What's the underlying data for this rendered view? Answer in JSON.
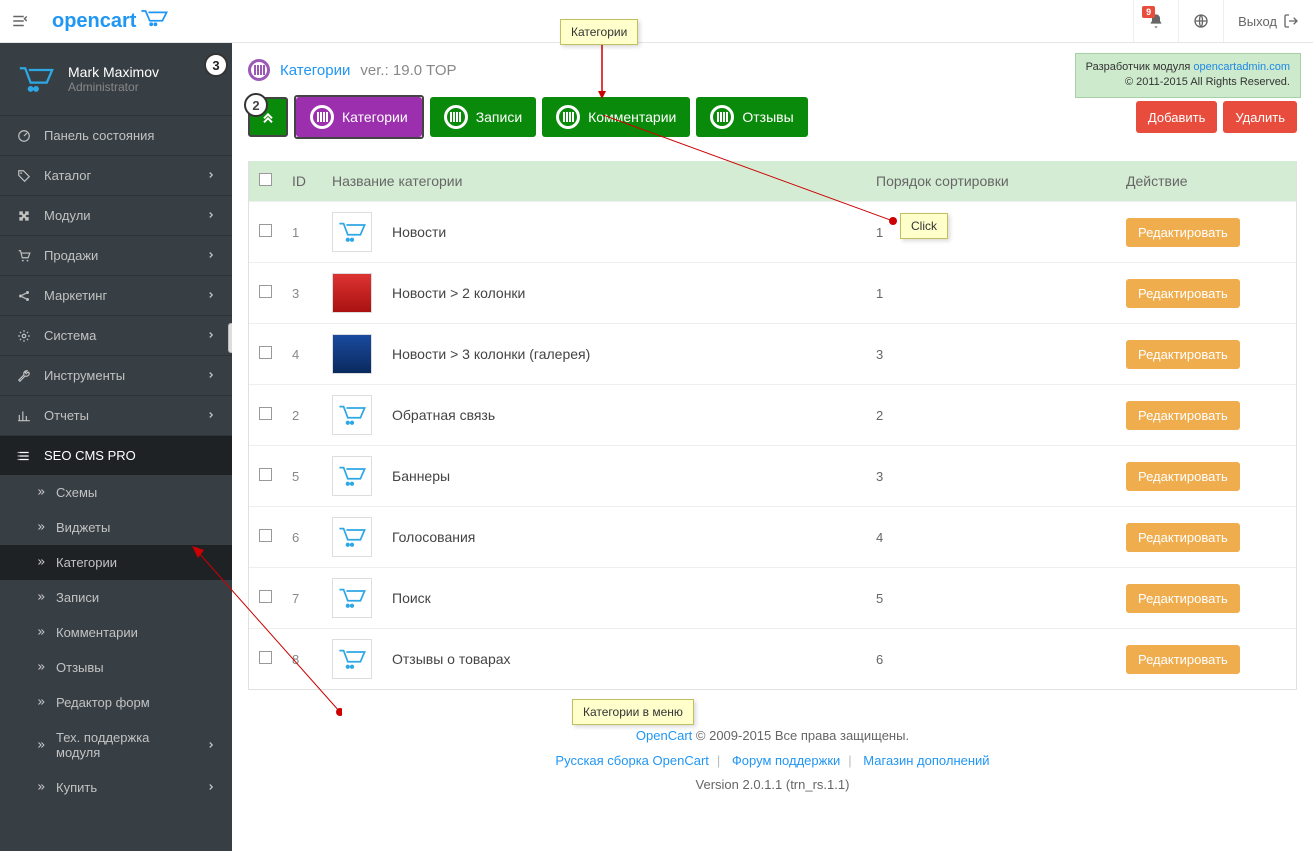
{
  "topbar": {
    "logo_text": "opencart",
    "badge_count": "9",
    "logout_label": "Выход"
  },
  "profile": {
    "name": "Mark Maximov",
    "role": "Administrator",
    "badge": "3"
  },
  "nav": [
    {
      "icon": "dashboard",
      "label": "Панель состояния",
      "chev": false
    },
    {
      "icon": "tag",
      "label": "Каталог",
      "chev": true
    },
    {
      "icon": "puzzle",
      "label": "Модули",
      "chev": true
    },
    {
      "icon": "cart",
      "label": "Продажи",
      "chev": true
    },
    {
      "icon": "share",
      "label": "Маркетинг",
      "chev": true
    },
    {
      "icon": "gear",
      "label": "Система",
      "chev": true
    },
    {
      "icon": "wrench",
      "label": "Инструменты",
      "chev": true
    },
    {
      "icon": "chart",
      "label": "Отчеты",
      "chev": true
    },
    {
      "icon": "list",
      "label": "SEO CMS PRO",
      "chev": false,
      "active": true
    }
  ],
  "subnav": [
    {
      "label": "Схемы"
    },
    {
      "label": "Виджеты"
    },
    {
      "label": "Категории",
      "active": true
    },
    {
      "label": "Записи"
    },
    {
      "label": "Комментарии"
    },
    {
      "label": "Отзывы"
    },
    {
      "label": "Редактор форм"
    },
    {
      "label": "Тех. поддержка модуля",
      "chev": true
    },
    {
      "label": "Купить",
      "chev": true
    }
  ],
  "devbox": {
    "line1_prefix": "Разработчик модуля ",
    "line1_link": "opencartadmin.com",
    "line2": "© 2011-2015 All Rights Reserved."
  },
  "breadcrumb": {
    "title": "Категории",
    "version": " ver.: 19.0 TOP",
    "badge": "2"
  },
  "tabs": [
    {
      "label": "Категории",
      "active": true
    },
    {
      "label": "Записи"
    },
    {
      "label": "Комментарии"
    },
    {
      "label": "Отзывы"
    }
  ],
  "actions": {
    "add": "Добавить",
    "delete": "Удалить"
  },
  "table": {
    "headers": {
      "id": "ID",
      "name": "Название категории",
      "sort": "Порядок сортировки",
      "action": "Действие"
    },
    "rows": [
      {
        "id": "1",
        "name": "Новости",
        "sort": "1",
        "img": "logo"
      },
      {
        "id": "3",
        "name": "Новости > 2 колонки",
        "sort": "1",
        "img": "photo1"
      },
      {
        "id": "4",
        "name": "Новости > 3 колонки (галерея)",
        "sort": "3",
        "img": "photo2"
      },
      {
        "id": "2",
        "name": "Обратная связь",
        "sort": "2",
        "img": "logo"
      },
      {
        "id": "5",
        "name": "Баннеры",
        "sort": "3",
        "img": "logo"
      },
      {
        "id": "6",
        "name": "Голосования",
        "sort": "4",
        "img": "logo"
      },
      {
        "id": "7",
        "name": "Поиск",
        "sort": "5",
        "img": "logo"
      },
      {
        "id": "8",
        "name": "Отзывы о товарах",
        "sort": "6",
        "img": "logo"
      }
    ],
    "edit_label": "Редактировать"
  },
  "footer": {
    "opencart_link": "OpenCart",
    "copyright": " © 2009-2015 Все права защищены.",
    "link1": "Русская сборка OpenCart",
    "link2": "Форум поддержки",
    "link3": "Магазин дополнений",
    "version": "Version 2.0.1.1 (trn_rs.1.1)"
  },
  "callouts": {
    "top": "Категории",
    "click": "Click",
    "menu": "Категории в меню"
  }
}
